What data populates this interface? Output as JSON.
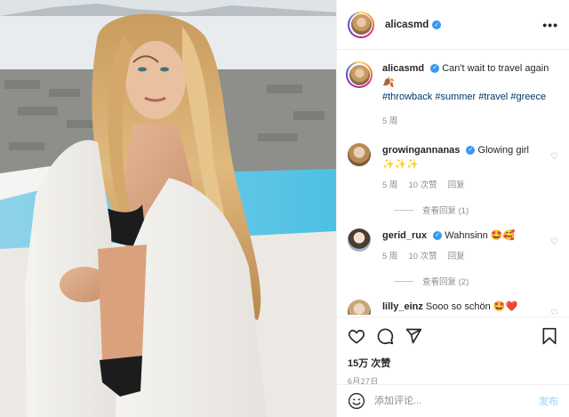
{
  "post": {
    "username": "alicasmd",
    "more_label": "•••"
  },
  "caption": {
    "username": "alicasmd",
    "text": "Can't wait to travel again",
    "emoji": "🍂",
    "hashtags": [
      "#throwback",
      "#summer",
      "#travel",
      "#greece"
    ],
    "time": "5 周"
  },
  "comments": [
    {
      "username": "growingannanas",
      "text": "Glowing girl",
      "emoji": "✨✨✨",
      "time": "5 周",
      "likes": "10 次赞",
      "reply": "回复",
      "view_replies": "查看回复 (1)"
    },
    {
      "username": "gerid_rux",
      "text": "Wahnsinn",
      "emoji": "🤩🥰",
      "time": "5 周",
      "likes": "10 次赞",
      "reply": "回复",
      "view_replies": "查看回复 (2)"
    },
    {
      "username": "lilly_einz",
      "text": "Sooo so schön",
      "emoji": "🤩❤️"
    }
  ],
  "stats": {
    "likes": "15万 次赞",
    "date": "6月27日"
  },
  "add_comment": {
    "placeholder": "添加评论...",
    "post_label": "发布"
  },
  "colors": {
    "verified": "#3897f0",
    "hashtag": "#00376b",
    "secondary_text": "#8e8e8e",
    "post_button_disabled": "#b2dffc",
    "pool_water": "#5fc7e6"
  },
  "icons": [
    "verified-icon",
    "more-options-icon",
    "heart-icon",
    "comment-icon",
    "share-icon",
    "bookmark-icon",
    "emoji-icon"
  ]
}
